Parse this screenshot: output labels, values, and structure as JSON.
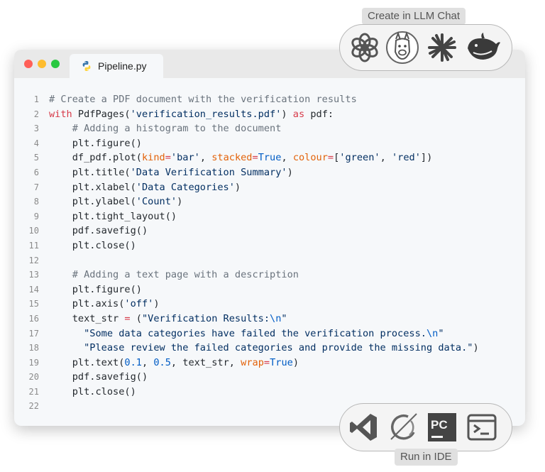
{
  "window": {
    "tab_filename": "Pipeline.py"
  },
  "llm_chat": {
    "label": "Create in LLM Chat",
    "icons": [
      "chatgpt-icon",
      "llama-icon",
      "claude-icon",
      "deepseek-icon"
    ]
  },
  "ide": {
    "label": "Run in IDE",
    "icons": [
      "vscode-icon",
      "eclipse-icon",
      "pycharm-icon",
      "terminal-icon"
    ],
    "pycharm_text": "PC"
  },
  "code_lines": [
    {
      "n": "1",
      "indent": "",
      "parts": [
        [
          "c",
          "# Create a PDF document with the verification results"
        ]
      ]
    },
    {
      "n": "2",
      "indent": "",
      "parts": [
        [
          "k",
          "with "
        ],
        [
          "t",
          "PdfPages("
        ],
        [
          "s",
          "'verification_results.pdf'"
        ],
        [
          "t",
          ") "
        ],
        [
          "k",
          "as"
        ],
        [
          "t",
          " pdf:"
        ]
      ]
    },
    {
      "n": "3",
      "indent": "    ",
      "parts": [
        [
          "c",
          "# Adding a histogram to the document"
        ]
      ]
    },
    {
      "n": "4",
      "indent": "    ",
      "parts": [
        [
          "t",
          "plt.figure()"
        ]
      ]
    },
    {
      "n": "5",
      "indent": "    ",
      "parts": [
        [
          "t",
          "df_pdf.plot("
        ],
        [
          "p",
          "kind"
        ],
        [
          "k",
          "="
        ],
        [
          "s",
          "'bar'"
        ],
        [
          "t",
          ", "
        ],
        [
          "p",
          "stacked"
        ],
        [
          "k",
          "="
        ],
        [
          "n",
          "True"
        ],
        [
          "t",
          ", "
        ],
        [
          "p",
          "colour"
        ],
        [
          "k",
          "="
        ],
        [
          "t",
          "["
        ],
        [
          "s",
          "'green'"
        ],
        [
          "t",
          ", "
        ],
        [
          "s",
          "'red'"
        ],
        [
          "t",
          "])"
        ]
      ]
    },
    {
      "n": "6",
      "indent": "    ",
      "parts": [
        [
          "t",
          "plt.title("
        ],
        [
          "s",
          "'Data Verification Summary'"
        ],
        [
          "t",
          ")"
        ]
      ]
    },
    {
      "n": "7",
      "indent": "    ",
      "parts": [
        [
          "t",
          "plt.xlabel("
        ],
        [
          "s",
          "'Data Categories'"
        ],
        [
          "t",
          ")"
        ]
      ]
    },
    {
      "n": "8",
      "indent": "    ",
      "parts": [
        [
          "t",
          "plt.ylabel("
        ],
        [
          "s",
          "'Count'"
        ],
        [
          "t",
          ")"
        ]
      ]
    },
    {
      "n": "9",
      "indent": "    ",
      "parts": [
        [
          "t",
          "plt.tight_layout()"
        ]
      ]
    },
    {
      "n": "10",
      "indent": "    ",
      "parts": [
        [
          "t",
          "pdf.savefig()"
        ]
      ]
    },
    {
      "n": "11",
      "indent": "    ",
      "parts": [
        [
          "t",
          "plt.close()"
        ]
      ]
    },
    {
      "n": "12",
      "indent": "",
      "parts": []
    },
    {
      "n": "13",
      "indent": "    ",
      "parts": [
        [
          "c",
          "# Adding a text page with a description"
        ]
      ]
    },
    {
      "n": "14",
      "indent": "    ",
      "parts": [
        [
          "t",
          "plt.figure()"
        ]
      ]
    },
    {
      "n": "15",
      "indent": "    ",
      "parts": [
        [
          "t",
          "plt.axis("
        ],
        [
          "s",
          "'off'"
        ],
        [
          "t",
          ")"
        ]
      ]
    },
    {
      "n": "16",
      "indent": "    ",
      "parts": [
        [
          "t",
          "text_str "
        ],
        [
          "k",
          "="
        ],
        [
          "t",
          " ("
        ],
        [
          "s",
          "\"Verification Results:"
        ],
        [
          "n",
          "\\n"
        ],
        [
          "s",
          "\""
        ]
      ]
    },
    {
      "n": "17",
      "indent": "      ",
      "parts": [
        [
          "s",
          "\"Some data categories have failed the verification process."
        ],
        [
          "n",
          "\\n"
        ],
        [
          "s",
          "\""
        ]
      ]
    },
    {
      "n": "18",
      "indent": "      ",
      "parts": [
        [
          "s",
          "\"Please review the failed categories and provide the missing data.\""
        ],
        [
          "t",
          ")"
        ]
      ]
    },
    {
      "n": "19",
      "indent": "    ",
      "parts": [
        [
          "t",
          "plt.text("
        ],
        [
          "n",
          "0.1"
        ],
        [
          "t",
          ", "
        ],
        [
          "n",
          "0.5"
        ],
        [
          "t",
          ", text_str, "
        ],
        [
          "p",
          "wrap"
        ],
        [
          "k",
          "="
        ],
        [
          "n",
          "True"
        ],
        [
          "t",
          ")"
        ]
      ]
    },
    {
      "n": "20",
      "indent": "    ",
      "parts": [
        [
          "t",
          "pdf.savefig()"
        ]
      ]
    },
    {
      "n": "21",
      "indent": "    ",
      "parts": [
        [
          "t",
          "plt.close()"
        ]
      ]
    },
    {
      "n": "22",
      "indent": "",
      "parts": []
    }
  ],
  "colors": {
    "comment": "#6a737d",
    "keyword": "#d73a49",
    "string": "#032f62",
    "param": "#e36209",
    "number": "#005cc5"
  }
}
